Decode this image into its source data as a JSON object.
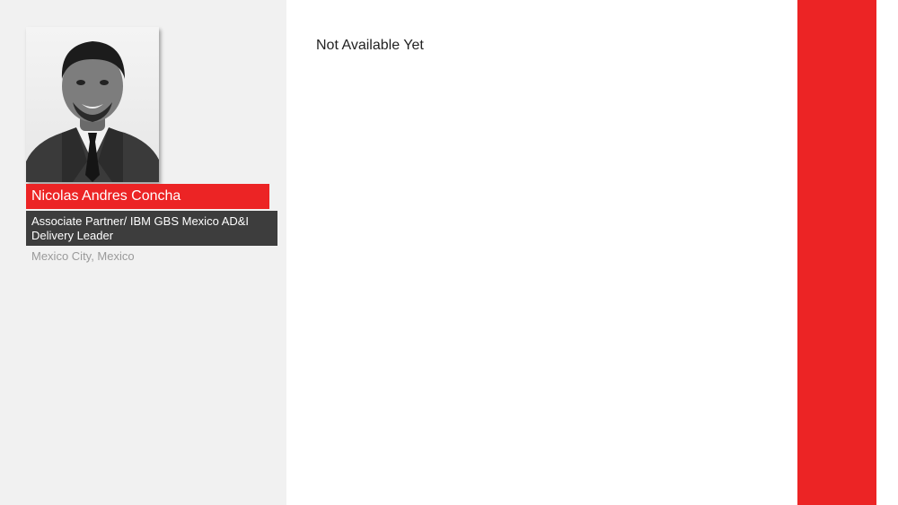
{
  "profile": {
    "name": "Nicolas Andres Concha",
    "role": "Associate Partner/ IBM GBS Mexico AD&I Delivery Leader",
    "location": "Mexico City, Mexico",
    "photo_icon": "person-portrait-icon"
  },
  "content": {
    "text": "Not Available Yet"
  },
  "colors": {
    "accent": "#ec2425",
    "panel": "#f1f1f1",
    "role_bar": "#3d3d3d"
  }
}
